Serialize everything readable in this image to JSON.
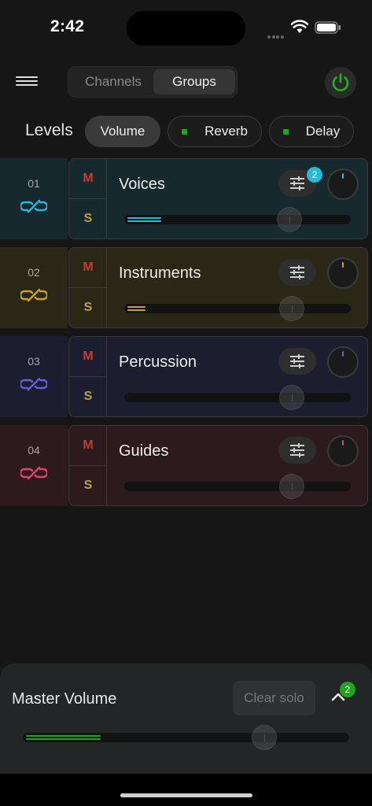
{
  "status": {
    "time": "2:42"
  },
  "header": {
    "tabs": [
      {
        "label": "Channels"
      },
      {
        "label": "Groups"
      }
    ],
    "active_tab": "Groups",
    "power_color": "#25b025"
  },
  "levels": {
    "label": "Levels",
    "pills": [
      {
        "label": "Volume"
      },
      {
        "label": "Reverb"
      },
      {
        "label": "Delay"
      }
    ],
    "active": "Volume"
  },
  "groups": [
    {
      "num": "01",
      "name": "Voices",
      "m": "M",
      "s": "S",
      "color": "#2bb8d6",
      "bg": "#15292e",
      "eq_badge": "2",
      "level": 0.73,
      "meter": 0.15
    },
    {
      "num": "02",
      "name": "Instruments",
      "m": "M",
      "s": "S",
      "color": "#c9a421",
      "bg": "#2a2717",
      "eq_badge": "",
      "level": 0.74,
      "meter": 0.08
    },
    {
      "num": "03",
      "name": "Percussion",
      "m": "M",
      "s": "S",
      "color": "#6360d9",
      "bg": "#1c1d2e",
      "eq_badge": "",
      "level": 0.74,
      "meter": 0.0
    },
    {
      "num": "04",
      "name": "Guides",
      "m": "M",
      "s": "S",
      "color": "#e0456b",
      "bg": "#2c1a1f",
      "eq_badge": "",
      "level": 0.74,
      "meter": 0.0
    }
  ],
  "master": {
    "title": "Master Volume",
    "clear_solo": "Clear solo",
    "badge": "2",
    "level": 0.74,
    "meter": 0.23,
    "color": "#21a321"
  }
}
